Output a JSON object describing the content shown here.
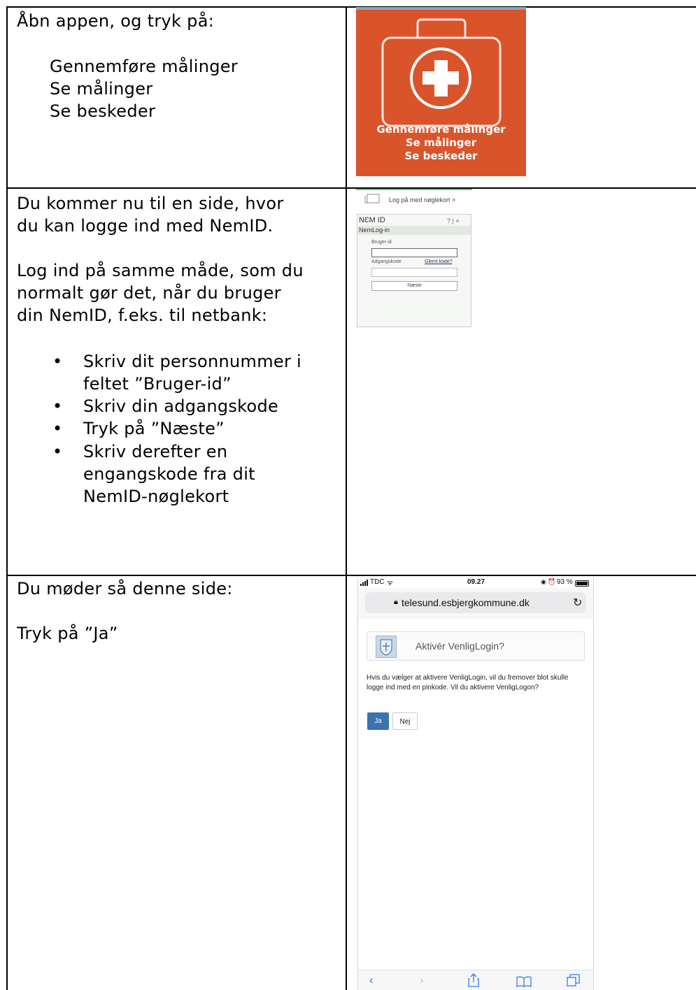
{
  "rows": [
    {
      "intro": "Åbn appen, og tryk på:",
      "options": [
        "Gennemføre målinger",
        "Se målinger",
        "Se beskeder"
      ]
    },
    {
      "intro_lines": [
        "Du kommer nu til en side, hvor",
        "du kan logge ind med NemID."
      ],
      "para_lines": [
        "Log ind på samme måde, som du",
        "normalt gør det, når du bruger",
        "din NemID, f.eks. til netbank:"
      ],
      "bullets": [
        [
          "Skriv dit personnummer i",
          "feltet ”Bruger-id”"
        ],
        [
          "Skriv din adgangskode"
        ],
        [
          "Tryk på ”Næste”"
        ],
        [
          "Skriv derefter en",
          "engangskode fra dit",
          "NemID-nøglekort"
        ]
      ]
    },
    {
      "intro": "Du møder så denne side:",
      "action": "Tryk på ”Ja”"
    }
  ],
  "app_icon": {
    "labels": [
      "Gennemføre målinger",
      "Se målinger",
      "Se beskeder"
    ],
    "color": "#d9542b"
  },
  "nemid": {
    "top_link": "Log på med nøglekort >",
    "logo": "NƐM ID",
    "header_ctrl": "? | ×",
    "subtitle": "NemLog-in",
    "user_label": "Bruger-id",
    "password_label": "Adgangskode",
    "forgot_link": "Glemt kode?",
    "next_button": "Næste"
  },
  "phone": {
    "carrier": "TDC",
    "time": "09.27",
    "battery": "93 %",
    "url": "telesund.esbjergkommune.dk",
    "panel_title": "Aktivér VenligLogin?",
    "message": "Hvis du vælger at aktivere VenligLogin, vil du fremover blot skulle logge ind med en pinkode. Vil du aktivere VenligLogon?",
    "yes_button": "Ja",
    "no_button": "Nej",
    "accent": "#3a73b0"
  }
}
